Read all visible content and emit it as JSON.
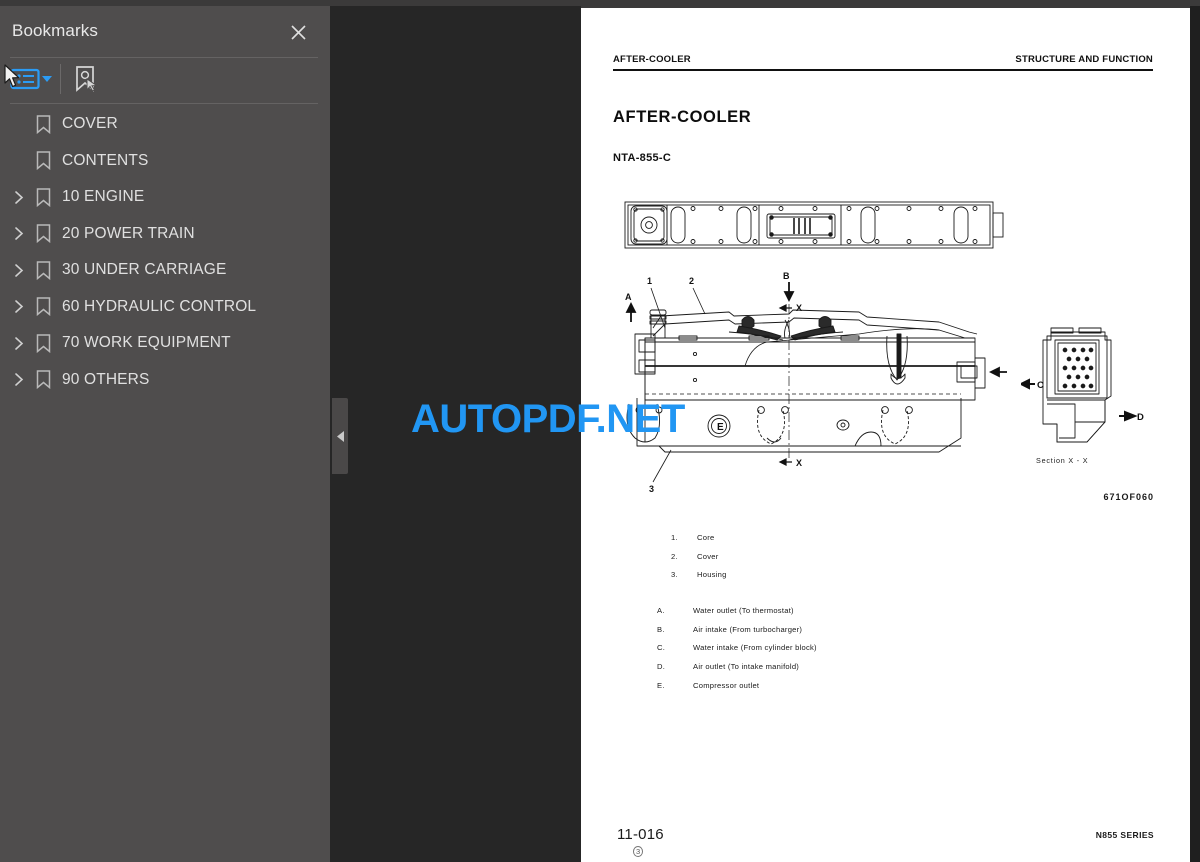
{
  "sidebar": {
    "title": "Bookmarks",
    "close_icon": "close-icon",
    "toolbar": {
      "list_options_icon": "list-options-icon",
      "caret_icon": "chevron-down-icon",
      "new_bookmark_icon": "new-bookmark-icon"
    },
    "accent_color": "#2196f3",
    "background_color": "#4f4d4d",
    "items": [
      {
        "label": "COVER",
        "expandable": false
      },
      {
        "label": "CONTENTS",
        "expandable": false
      },
      {
        "label": "10 ENGINE",
        "expandable": true
      },
      {
        "label": "20 POWER TRAIN",
        "expandable": true
      },
      {
        "label": "30 UNDER CARRIAGE",
        "expandable": true
      },
      {
        "label": "60 HYDRAULIC CONTROL",
        "expandable": true
      },
      {
        "label": "70 WORK EQUIPMENT",
        "expandable": true
      },
      {
        "label": "90 OTHERS",
        "expandable": true
      }
    ]
  },
  "viewer": {
    "background_color": "#262626",
    "collapse_handle_icon": "collapse-left-icon",
    "watermark": "AUTOPDF.NET",
    "watermark_color": "#2196f3"
  },
  "page": {
    "header": {
      "left": "AFTER-COOLER",
      "right": "STRUCTURE AND FUNCTION"
    },
    "title": "AFTER-COOLER",
    "subtitle": "NTA-855-C",
    "figure_id": "671OF060",
    "section_label": "Section X - X",
    "callouts": {
      "num_1": "1",
      "num_2": "2",
      "num_3": "3",
      "arrow_a": "A",
      "arrow_b": "B",
      "arrow_c": "C",
      "arrow_d": "D",
      "circle_e": "E",
      "section_x_top": "X",
      "section_x_bottom": "X"
    },
    "legend_numbered": [
      {
        "key": "1.",
        "text": "Core"
      },
      {
        "key": "2.",
        "text": "Cover"
      },
      {
        "key": "3.",
        "text": "Housing"
      }
    ],
    "legend_lettered": [
      {
        "key": "A.",
        "text": "Water outlet (To thermostat)"
      },
      {
        "key": "B.",
        "text": "Air intake (From turbocharger)"
      },
      {
        "key": "C.",
        "text": "Water intake (From cylinder block)"
      },
      {
        "key": "D.",
        "text": "Air outlet (To intake manifold)"
      },
      {
        "key": "E.",
        "text": "Compressor outlet"
      }
    ],
    "footer": {
      "page_number": "11-016",
      "revision": "3",
      "series": "N855 SERIES"
    }
  }
}
